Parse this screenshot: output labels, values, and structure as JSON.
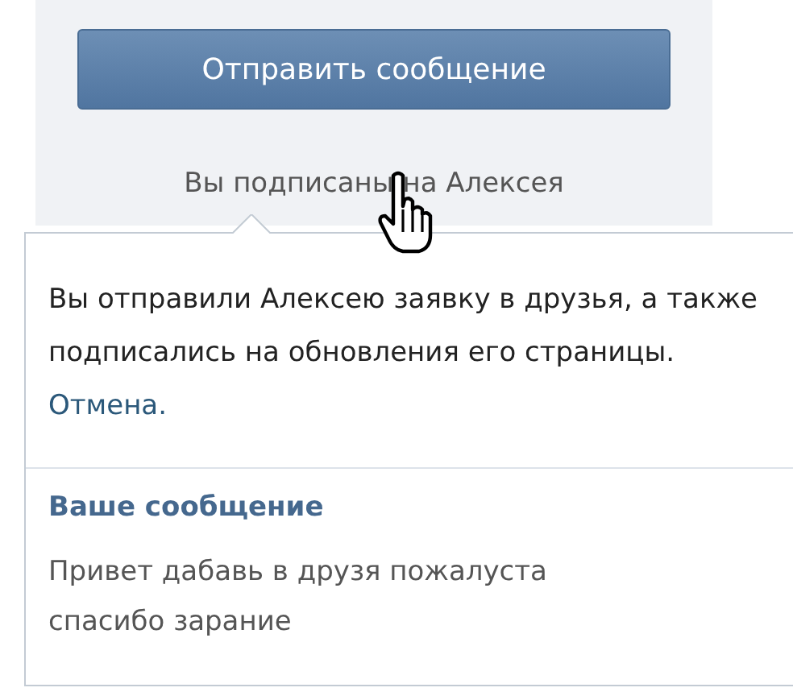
{
  "send_button": {
    "label": "Отправить сообщение"
  },
  "subscription_status": "Вы подписаны на Алексея",
  "popup": {
    "notice": "Вы отправили Алексею заявку в друзья, а также подписались на обновления его страницы.",
    "cancel_link": "Отмена.",
    "message_heading": "Ваше сообщение",
    "message_text": "Привет дабавь в друзя пожалуста спасибо зарание"
  }
}
